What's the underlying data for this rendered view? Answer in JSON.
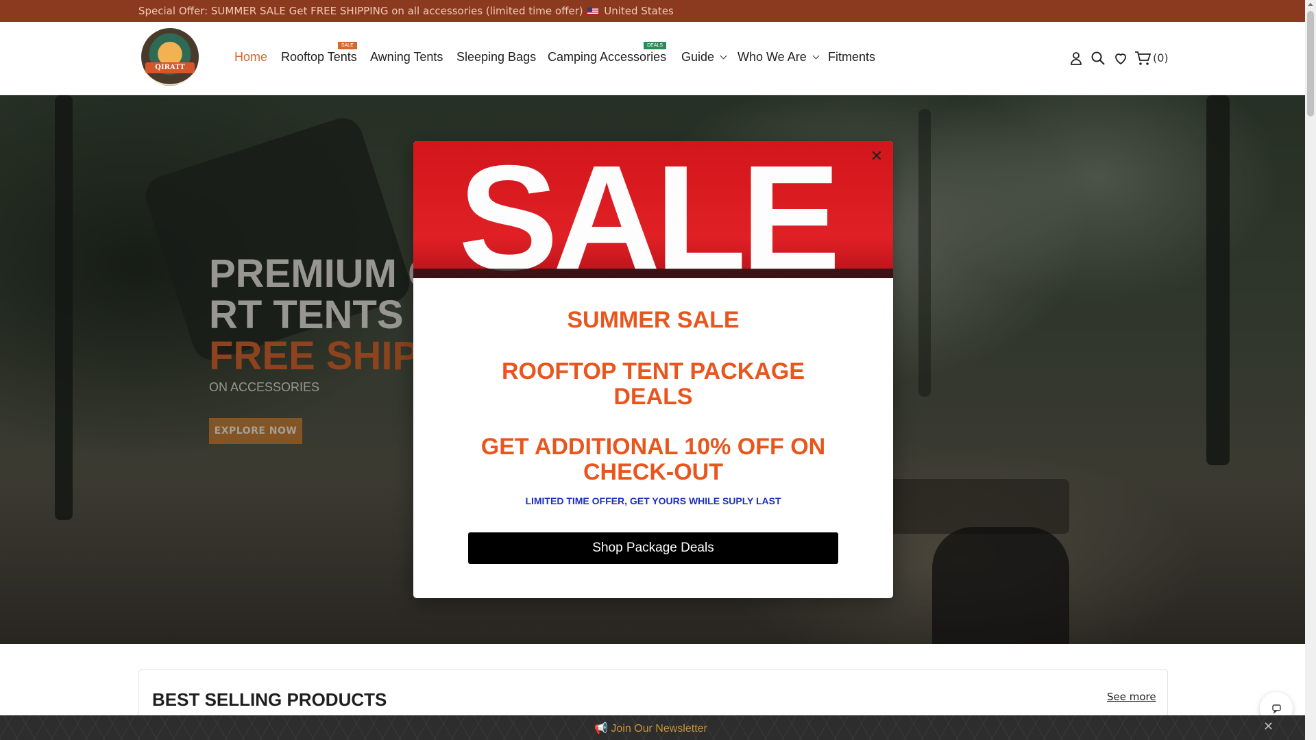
{
  "topbar": {
    "text": "Special Offer: SUMMER SALE Get FREE SHIPPING on all accessories (limited time offer)",
    "country": "United States"
  },
  "header": {
    "logo_text": "QIRATT",
    "nav": [
      {
        "label": "Home",
        "active": true
      },
      {
        "label": "Rooftop Tents",
        "badge": "SALE"
      },
      {
        "label": "Awning Tents"
      },
      {
        "label": "Sleeping Bags"
      },
      {
        "label": "Camping Accessories",
        "badge": "DEALS"
      },
      {
        "label": "Guide",
        "dropdown": true
      },
      {
        "label": "Who We Are",
        "dropdown": true
      },
      {
        "label": "Fitments"
      }
    ],
    "icons": [
      "user-icon",
      "search-icon",
      "heart-icon",
      "cart-icon"
    ],
    "cart_count": "(0)"
  },
  "hero": {
    "line1": "PREMIUM QU",
    "line2": "RT TENTS & ",
    "line3": "FREE SHIPPI",
    "subtitle": "ON ACCESSORIES",
    "cta": "EXPLORE NOW"
  },
  "modal": {
    "banner_word": "SALE",
    "heading1": "SUMMER SALE",
    "heading2": "ROOFTOP TENT PACKAGE DEALS",
    "heading3": "GET ADDITIONAL 10% OFF ON CHECK-OUT",
    "note": "LIMITED TIME OFFER, GET YOURS WHILE SUPLY LAST",
    "button": "Shop Package Deals",
    "close_icon": "close-icon"
  },
  "best_selling": {
    "title": "BEST SELLING PRODUCTS",
    "see_more": "See more"
  },
  "newsletter": {
    "label": "Join Our Newsletter",
    "icon": "megaphone-icon"
  },
  "colors": {
    "accent": "#d8672f",
    "topbar": "#8b3a1f",
    "modal_heading": "#e8561e",
    "modal_note": "#1a2fbf"
  }
}
